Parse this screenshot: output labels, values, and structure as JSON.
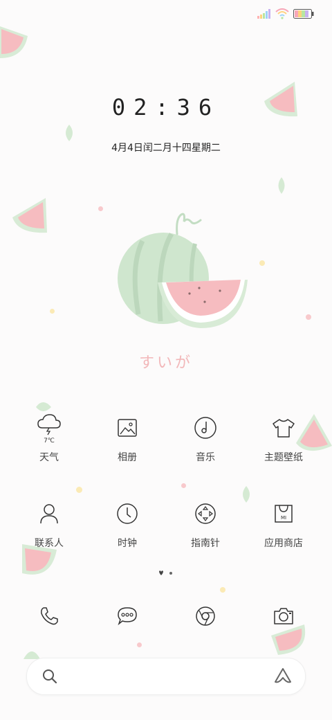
{
  "lock": {
    "time": "02:36",
    "date": "4月4日闰二月十四星期二"
  },
  "signature": "すいが",
  "apps_row1": [
    {
      "label": "天气",
      "icon": "weather-icon",
      "badge": "7℃"
    },
    {
      "label": "相册",
      "icon": "gallery-icon"
    },
    {
      "label": "音乐",
      "icon": "music-icon"
    },
    {
      "label": "主题壁纸",
      "icon": "themes-icon"
    }
  ],
  "apps_row2": [
    {
      "label": "联系人",
      "icon": "contacts-icon"
    },
    {
      "label": "时钟",
      "icon": "clock-icon"
    },
    {
      "label": "指南针",
      "icon": "compass-icon"
    },
    {
      "label": "应用商店",
      "icon": "app-store-icon",
      "badge": "MI"
    }
  ],
  "dock": [
    {
      "icon": "phone-icon"
    },
    {
      "icon": "messages-icon"
    },
    {
      "icon": "browser-icon"
    },
    {
      "icon": "camera-icon"
    }
  ],
  "colors": {
    "melon_green": "#c9e3cc",
    "melon_pink": "#f4b6ba",
    "signature": "#f2b7b9"
  }
}
